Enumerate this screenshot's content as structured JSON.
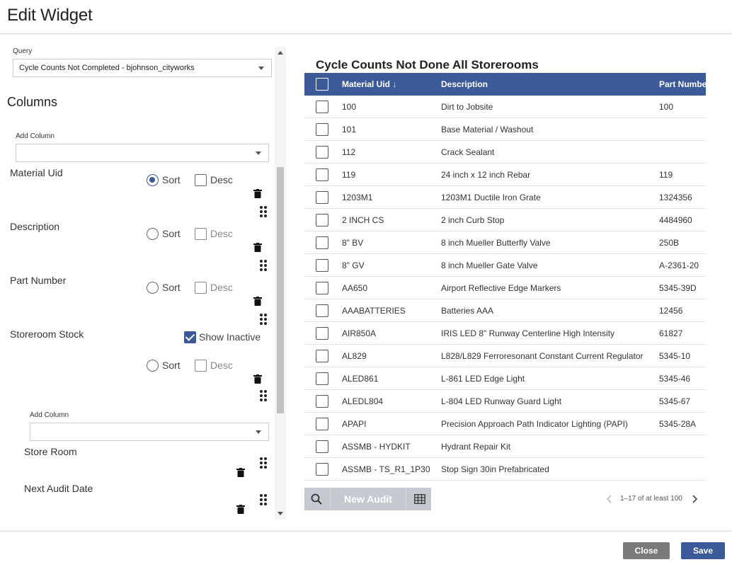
{
  "header": {
    "title": "Edit Widget"
  },
  "query": {
    "label": "Query",
    "value": "Cycle Counts Not Completed - bjohnson_cityworks"
  },
  "columns": {
    "title": "Columns",
    "add_column_label": "Add Column",
    "add_column_value": "",
    "items": [
      {
        "name": "Material Uid",
        "sort_label": "Sort",
        "sort_selected": true,
        "desc_label": "Desc",
        "desc_enabled": true
      },
      {
        "name": "Description",
        "sort_label": "Sort",
        "sort_selected": false,
        "desc_label": "Desc",
        "desc_enabled": false
      },
      {
        "name": "Part Number",
        "sort_label": "Sort",
        "sort_selected": false,
        "desc_label": "Desc",
        "desc_enabled": false
      },
      {
        "name": "Storeroom Stock",
        "show_inactive_label": "Show Inactive",
        "show_inactive_checked": true,
        "sort_label": "Sort",
        "sort_selected": false,
        "desc_label": "Desc",
        "desc_enabled": false
      }
    ],
    "sub": {
      "add_column_label": "Add Column",
      "add_column_value": "",
      "items": [
        {
          "name": "Store Room"
        },
        {
          "name": "Next Audit Date"
        }
      ]
    }
  },
  "grid": {
    "title": "Cycle Counts Not Done All Storerooms",
    "headers": {
      "material_uid": "Material Uid",
      "sort_arrow": "↓",
      "description": "Description",
      "part_number": "Part Number"
    },
    "rows": [
      {
        "uid": "100",
        "description": "Dirt to Jobsite",
        "part": "100"
      },
      {
        "uid": "101",
        "description": "Base Material / Washout",
        "part": ""
      },
      {
        "uid": "112",
        "description": "Crack Sealant",
        "part": ""
      },
      {
        "uid": "119",
        "description": "24 inch x 12 inch Rebar",
        "part": "119"
      },
      {
        "uid": "1203M1",
        "description": "1203M1 Ductile Iron Grate",
        "part": "1324356"
      },
      {
        "uid": "2 INCH CS",
        "description": "2 inch Curb Stop",
        "part": "4484960"
      },
      {
        "uid": "8\" BV",
        "description": "8 inch Mueller Butterfly Valve",
        "part": "250B"
      },
      {
        "uid": "8\" GV",
        "description": "8 inch Mueller Gate Valve",
        "part": "A-2361-20"
      },
      {
        "uid": "AA650",
        "description": "Airport Reflective Edge Markers",
        "part": "5345-39D"
      },
      {
        "uid": "AAABATTERIES",
        "description": "Batteries AAA",
        "part": "12456"
      },
      {
        "uid": "AIR850A",
        "description": "IRIS LED 8\" Runway Centerline High Intensity",
        "part": "61827"
      },
      {
        "uid": "AL829",
        "description": "L828/L829 Ferroresonant Constant Current Regulator",
        "part": "5345-10"
      },
      {
        "uid": "ALED861",
        "description": "L-861 LED Edge Light",
        "part": "5345-46"
      },
      {
        "uid": "ALEDL804",
        "description": "L-804 LED Runway Guard Light",
        "part": "5345-67"
      },
      {
        "uid": "APAPI",
        "description": "Precision Approach Path Indicator Lighting (PAPI)",
        "part": "5345-28A"
      },
      {
        "uid": "ASSMB - HYDKIT",
        "description": "Hydrant Repair Kit",
        "part": ""
      },
      {
        "uid": "ASSMB - TS_R1_1P30",
        "description": "Stop Sign 30in Prefabricated",
        "part": ""
      }
    ],
    "footer": {
      "new_audit_label": "New Audit",
      "pager_text": "1–17 of at least 100"
    }
  },
  "actions": {
    "close_label": "Close",
    "save_label": "Save"
  },
  "colors": {
    "accent": "#3c5a9a",
    "close_button": "#7a7a7a",
    "disabled_button": "#c6c9cf"
  },
  "icons": {
    "search": "search-icon",
    "table": "table-icon",
    "trash": "trash-icon",
    "drag": "drag-handle-icon",
    "prev": "chevron-left-icon",
    "next": "chevron-right-icon"
  }
}
